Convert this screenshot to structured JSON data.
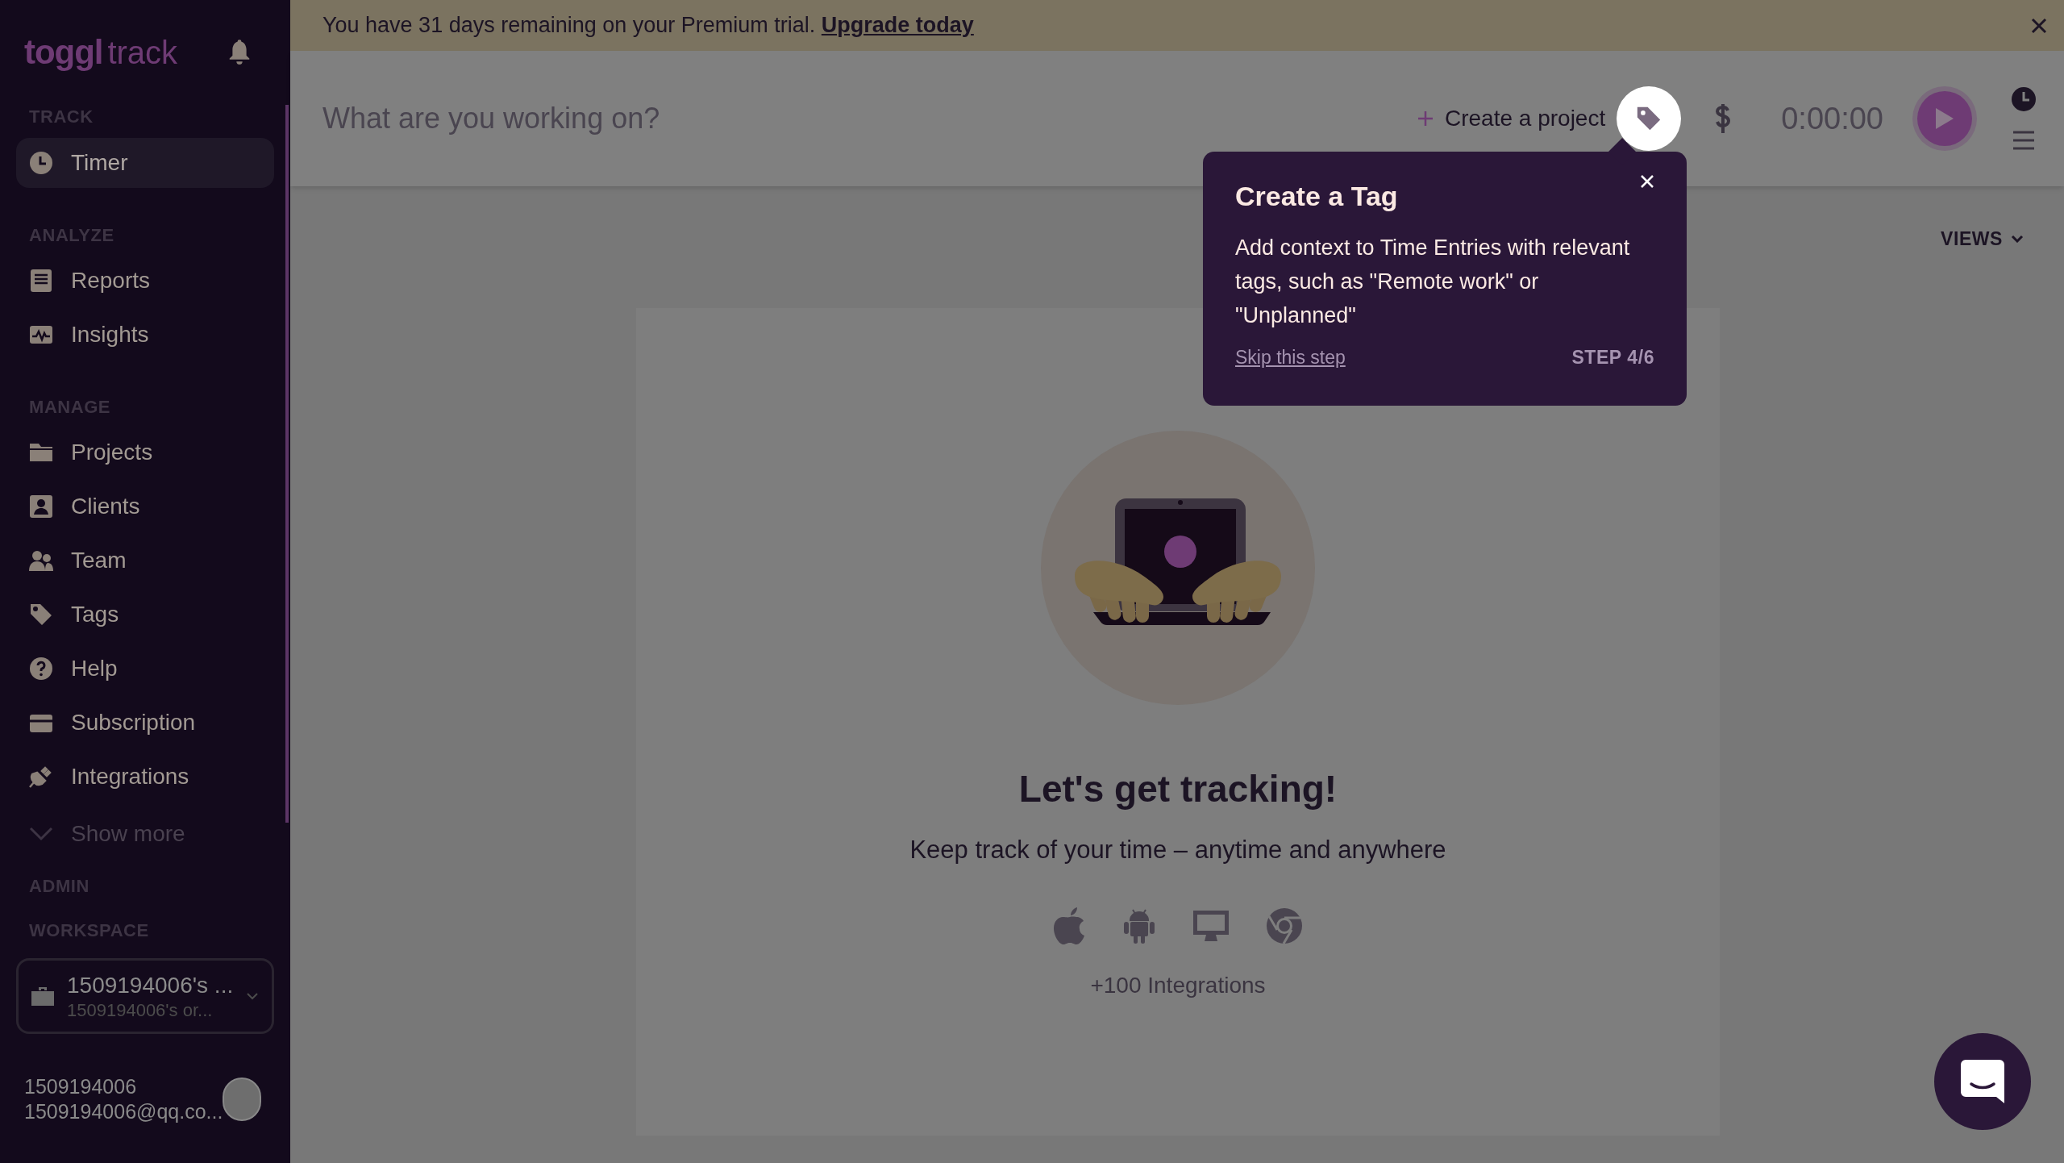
{
  "banner": {
    "text": "You have 31 days remaining on your Premium trial.",
    "link": "Upgrade today"
  },
  "sidebar": {
    "logo": {
      "brand": "toggl",
      "product": "track"
    },
    "sections": [
      {
        "label": "TRACK",
        "items": [
          {
            "label": "Timer",
            "selected": true
          }
        ]
      },
      {
        "label": "ANALYZE",
        "items": [
          {
            "label": "Reports",
            "selected": false
          },
          {
            "label": "Insights",
            "selected": false
          }
        ]
      },
      {
        "label": "MANAGE",
        "items": [
          {
            "label": "Projects",
            "selected": false
          },
          {
            "label": "Clients",
            "selected": false
          },
          {
            "label": "Team",
            "selected": false
          },
          {
            "label": "Tags",
            "selected": false
          },
          {
            "label": "Help",
            "selected": false
          },
          {
            "label": "Subscription",
            "selected": false
          },
          {
            "label": "Integrations",
            "selected": false
          }
        ]
      }
    ],
    "show_more": "Show more",
    "admin_label": "ADMIN",
    "workspace": {
      "label": "WORKSPACE",
      "name": "1509194006's ...",
      "organization": "1509194006's or..."
    },
    "user": {
      "name": "1509194006",
      "email": "1509194006@qq.co..."
    }
  },
  "timer_bar": {
    "placeholder": "What are you working on?",
    "create_project": "Create a project",
    "duration": "0:00:00"
  },
  "tooltip": {
    "title": "Create a Tag",
    "body": "Add context to Time Entries with relevant tags, such as \"Remote work\" or \"Unplanned\"",
    "skip": "Skip this step",
    "step": "STEP 4/6"
  },
  "views": "VIEWS",
  "empty_state": {
    "title": "Let's get tracking!",
    "subtitle": "Keep track of your time – anytime and anywhere",
    "integrations": "+100 Integrations"
  }
}
